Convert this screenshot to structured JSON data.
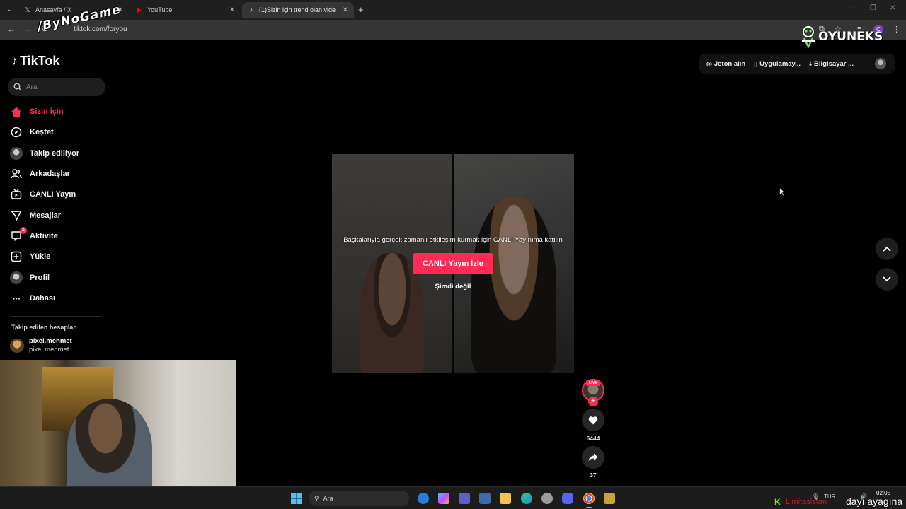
{
  "browser": {
    "tabs": [
      {
        "title": "Anasayfa / X",
        "favicon": "x-icon"
      },
      {
        "title": "YouTube",
        "favicon": "youtube-icon"
      },
      {
        "title": "(1)Sizin için trend olan vide",
        "favicon": "tiktok-icon"
      }
    ],
    "url": "tiktok.com/foryou",
    "profile_initial": "C"
  },
  "overlays": {
    "streamer_logo": "/ByNoGame",
    "sponsor_brand": "OYUNEKS",
    "ticker_red": "Limitasistan",
    "ticker_text": "dayı ayagına"
  },
  "tiktok": {
    "logo": "TikTok",
    "search_placeholder": "Ara",
    "sidebar": [
      {
        "label": "Sizin İçin",
        "icon": "home-icon",
        "active": true
      },
      {
        "label": "Keşfet",
        "icon": "compass-icon"
      },
      {
        "label": "Takip ediliyor",
        "icon": "avatar"
      },
      {
        "label": "Arkadaşlar",
        "icon": "friends-icon"
      },
      {
        "label": "CANLI Yayın",
        "icon": "live-tv-icon"
      },
      {
        "label": "Mesajlar",
        "icon": "send-icon"
      },
      {
        "label": "Aktivite",
        "icon": "activity-icon",
        "badge": "1"
      },
      {
        "label": "Yükle",
        "icon": "upload-icon"
      },
      {
        "label": "Profil",
        "icon": "avatar"
      },
      {
        "label": "Dahası",
        "icon": "more-icon"
      }
    ],
    "following_heading": "Takip edilen hesaplar",
    "following": [
      {
        "display_name": "pixel.mehmet",
        "username": "pixel.mehmet"
      }
    ],
    "top_actions": {
      "coins": "Jeton alın",
      "app": "Uygulamay...",
      "desktop": "Bilgisayar ..."
    },
    "live_prompt": {
      "message": "Başkalarıyla gerçek zamanlı etkileşim kurmak için CANLI Yayınıma katılın",
      "watch_button": "CANLI Yayın İzle",
      "dismiss": "Şimdi değil"
    },
    "actions": {
      "live_tag": "LIVE",
      "likes": "6444",
      "shares": "37"
    }
  },
  "taskbar": {
    "search_placeholder": "Ara",
    "language": "TUR",
    "time": "02:05"
  },
  "colors": {
    "tiktok_pink": "#fe2c55",
    "background": "#000000"
  }
}
